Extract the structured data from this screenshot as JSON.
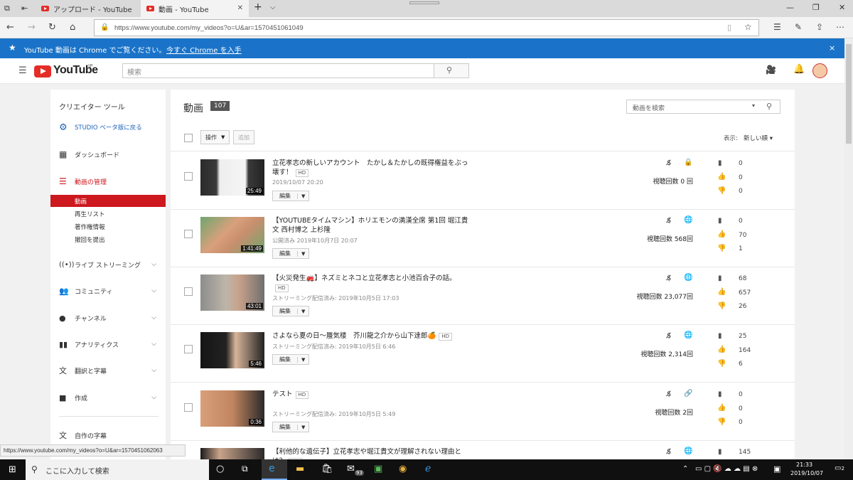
{
  "browser": {
    "tabs": [
      {
        "title": "アップロード - YouTube"
      },
      {
        "title": "動画 - YouTube"
      }
    ],
    "url": "https://www.youtube.com/my_videos?o=U&ar=1570451061049"
  },
  "banner": {
    "message": "YouTube 動画は Chrome でご覧ください。",
    "link": "今すぐ Chrome を入手",
    "close": "×"
  },
  "header": {
    "logo_text": "YouTube",
    "region": "JP",
    "search_placeholder": "検索"
  },
  "sidebar": {
    "title": "クリエイター ツール",
    "studio_beta": "STUDIO ベータ版に戻る",
    "dashboard": "ダッシュボード",
    "video_manager": "動画の管理",
    "sub_items": [
      "動画",
      "再生リスト",
      "著作権情報",
      "撤回を提出"
    ],
    "sections": [
      "ライブ ストリーミング",
      "コミュニティ",
      "チャンネル",
      "アナリティクス",
      "翻訳と字幕",
      "作成"
    ],
    "bottom": "自作の字幕"
  },
  "main": {
    "heading": "動画",
    "count": "107",
    "search_placeholder": "動画を検索",
    "actions_label": "操作",
    "add_label": "追加",
    "sort_label": "表示:",
    "sort_value": "新しい順",
    "edit_label": "編集",
    "videos": [
      {
        "title": "立花孝志の新しいアカウント　たかし＆たかしの既得権益をぶっ壊す！",
        "hd": "HD",
        "date": "2019/10/07 20:20",
        "duration": "25:49",
        "views": "視聴回数 0 回",
        "visibility": "lock",
        "comments": "0",
        "likes": "0",
        "dislikes": "0"
      },
      {
        "title": "【YOUTUBEタイムマシン】ホリエモンの満漢全席 第1回 堀江貴文 西村博之 上杉隆",
        "hd": "",
        "date": "公開済み 2019年10月7日 20:07",
        "duration": "1:41:49",
        "views": "視聴回数 568回",
        "visibility": "globe",
        "comments": "0",
        "likes": "70",
        "dislikes": "1"
      },
      {
        "title": "【火災発生🚒】ネズミとネコと立花孝志と小池百合子の話。",
        "hd": "HD",
        "date": "ストリーミング配信済み: 2019年10月5日 17:03",
        "duration": "43:01",
        "views": "視聴回数 23,077回",
        "visibility": "globe",
        "comments": "68",
        "likes": "657",
        "dislikes": "26"
      },
      {
        "title": "さよなら夏の日～蜃気楼　芥川龍之介から山下達郎🍊",
        "hd": "HD",
        "date": "ストリーミング配信済み: 2019年10月5日 6:46",
        "duration": "5:46",
        "views": "視聴回数 2,314回",
        "visibility": "globe",
        "comments": "25",
        "likes": "164",
        "dislikes": "6"
      },
      {
        "title": "テスト",
        "hd": "HD",
        "date": "ストリーミング配信済み: 2019年10月5日 5:49",
        "duration": "0:36",
        "views": "視聴回数 2回",
        "visibility": "link",
        "comments": "0",
        "likes": "0",
        "dislikes": "0"
      },
      {
        "title": "【利他的な遺伝子】立花孝志や堀江貴文が理解されない理由とは？",
        "hd": "HD",
        "date": "",
        "duration": "",
        "views": "",
        "visibility": "globe",
        "comments": "145",
        "likes": "",
        "dislikes": ""
      }
    ]
  },
  "status_url": "https://www.youtube.com/my_videos?o=U&ar=1570451062063",
  "taskbar": {
    "search_placeholder": "ここに入力して検索",
    "mail_badge": "93",
    "time": "21:33",
    "date": "2019/10/07",
    "notifications": "2"
  },
  "colors": {
    "accent": "#cc181e",
    "banner": "#1a73c8",
    "link_blue": "#1c62b9"
  }
}
